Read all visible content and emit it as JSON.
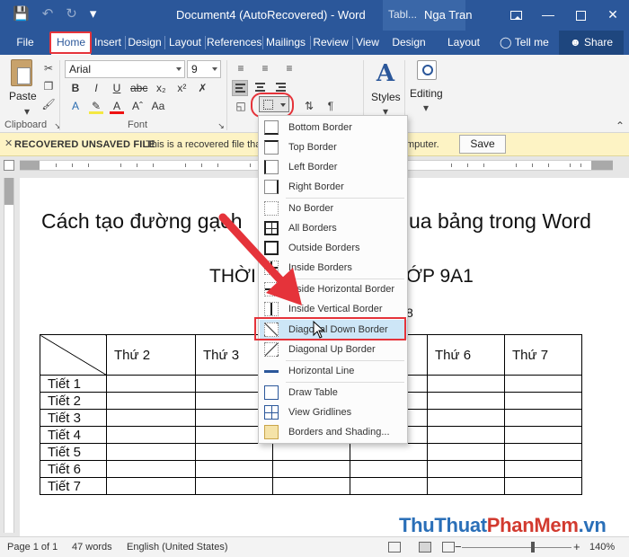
{
  "window": {
    "title": "Document4 (AutoRecovered)  -  Word",
    "context_tab_group": "Tabl...",
    "user": "Nga Tran"
  },
  "tabs": [
    "File",
    "Home",
    "Insert",
    "Design",
    "Layout",
    "References",
    "Mailings",
    "Review",
    "View",
    "Design",
    "Layout"
  ],
  "tell_me": "Tell me",
  "share": "Share",
  "ribbon": {
    "paste": "Paste",
    "font_name": "Arial",
    "font_size": "9",
    "styles": "Styles",
    "editing": "Editing",
    "groups": [
      "Clipboard",
      "Font"
    ]
  },
  "message_bar": {
    "title": "RECOVERED UNSAVED FILE",
    "text": "This is a recovered file tha",
    "text_tail": "mputer.",
    "save": "Save"
  },
  "document": {
    "title_left": "Cách tạo đường gạch",
    "title_right": "ua bảng trong Word",
    "subtitle_left": "THỜI",
    "subtitle_right": "ỚP 9A1",
    "year_fragment": "8",
    "table": {
      "headers": [
        "",
        "Thứ 2",
        "Thứ 3",
        "",
        "",
        "Thứ 6",
        "Thứ 7"
      ],
      "rows": [
        "Tiết 1",
        "Tiết 2",
        "Tiết 3",
        "Tiết 4",
        "Tiết 5",
        "Tiết 6",
        "Tiết 7"
      ]
    }
  },
  "borders_menu": {
    "items": [
      "Bottom Border",
      "Top Border",
      "Left Border",
      "Right Border",
      "No Border",
      "All Borders",
      "Outside Borders",
      "Inside Borders",
      "Inside Horizontal Border",
      "Inside Vertical Border",
      "Diagonal Down Border",
      "Diagonal Up Border",
      "Horizontal Line",
      "Draw Table",
      "View Gridlines",
      "Borders and Shading..."
    ],
    "highlighted": "Diagonal Down Border"
  },
  "status_bar": {
    "page": "Page 1 of 1",
    "words": "47 words",
    "language": "English (United States)",
    "zoom": "140%"
  },
  "watermark": {
    "part1": "ThuThuat",
    "part2": "PhanMem",
    "part3": ".vn"
  },
  "colors": {
    "word_blue": "#2b579a",
    "highlight_red": "#e5333a",
    "menu_highlight": "#cde6f7"
  }
}
